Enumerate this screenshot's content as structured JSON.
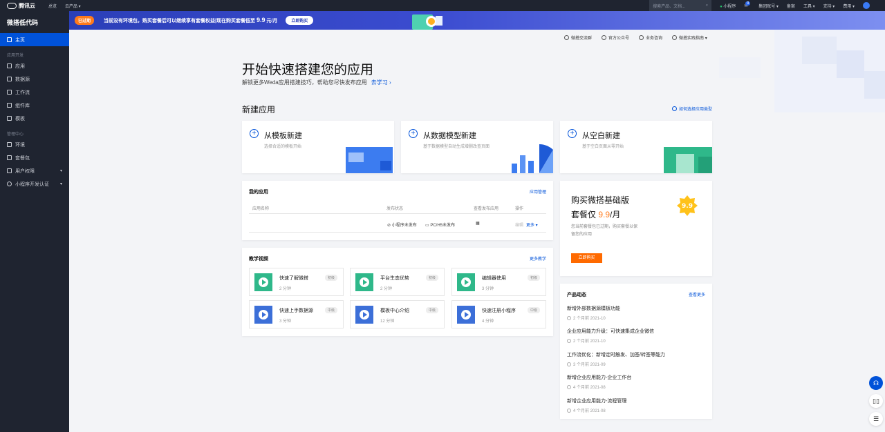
{
  "topbar": {
    "brand": "腾讯云",
    "nav": [
      "总览",
      "云产品 ▾"
    ],
    "search_placeholder": "搜索产品、文档...",
    "right_links": [
      "小程序",
      "集团账号 ▾",
      "备案",
      "工具 ▾",
      "支持 ▾",
      "费用 ▾"
    ],
    "mail_badge": "9"
  },
  "sidebar": {
    "title": "微搭低代码",
    "home": "主页",
    "group1": "应用开发",
    "group1_items": [
      "应用",
      "数据源",
      "工作流",
      "组件库",
      "模板"
    ],
    "group2": "管理中心",
    "group2_items": [
      "环境",
      "套餐包",
      "用户权限",
      "小程序开发认证"
    ]
  },
  "banner": {
    "expired": "已过期",
    "message": "当前没有环境包，购买套餐后可以继续享有套餐权益|现在购买套餐低至",
    "price": "9.9",
    "unit": "元/月",
    "buy_button": "立即购买"
  },
  "links": [
    "微搭交流群",
    "官方公众号",
    "业务咨询",
    "微搭实践指南 ▾"
  ],
  "hero": {
    "title": "开始快速搭建您的应用",
    "subtitle": "解锁更多Weda应用搭建技巧，帮助您尽快发布应用",
    "learn": "去学习 ›"
  },
  "create": {
    "title": "新建应用",
    "help": "如何选择应用类型",
    "cards": [
      {
        "title": "从模板新建",
        "desc": "选择合适的模板开始"
      },
      {
        "title": "从数据模型新建",
        "desc": "基于数据模型自动生成增删改查页面"
      },
      {
        "title": "从空白新建",
        "desc": "基于空白页面从零开始"
      }
    ]
  },
  "my_apps": {
    "title": "我的应用",
    "manage": "应用管理",
    "columns": [
      "应用名称",
      "发布状态",
      "查看发布应用",
      "操作"
    ],
    "row": {
      "status1": "小程序未发布",
      "status2": "PC/H5未发布",
      "edit": "编辑",
      "more": "更多 ▾"
    }
  },
  "videos": {
    "title": "教学视频",
    "more": "更多教学",
    "items": [
      {
        "title": "快速了解微搭",
        "duration": "2 分钟",
        "level": "初级"
      },
      {
        "title": "平台生态优势",
        "duration": "2 分钟",
        "level": "初级"
      },
      {
        "title": "编辑器使用",
        "duration": "3 分钟",
        "level": "初级"
      },
      {
        "title": "快速上手数据源",
        "duration": "3 分钟",
        "level": "中级"
      },
      {
        "title": "模板中心介绍",
        "duration": "12 分钟",
        "level": "中级"
      },
      {
        "title": "快速注册小程序",
        "duration": "4 分钟",
        "level": "中级"
      }
    ]
  },
  "buy": {
    "line1": "购买微搭基础版",
    "line2_prefix": "套餐仅 ",
    "price": "9.9",
    "line2_suffix": "/月",
    "desc": "您当前套餐包已过期，购买套餐以保留您的应用",
    "button": "立即购买",
    "stamp": "9.9"
  },
  "news": {
    "title": "产品动态",
    "more": "查看更多",
    "items": [
      {
        "text": "新增外部数据源模板功能",
        "time": "2 个月前 2021-10"
      },
      {
        "text": "企业应用能力升级：可快速集成企业微信",
        "time": "2 个月前 2021-10"
      },
      {
        "text": "工作流优化：新增定时触发、加签/转签等能力",
        "time": "3 个月前 2021-09"
      },
      {
        "text": "新增企业应用能力-企业工作台",
        "time": "4 个月前 2021-08"
      },
      {
        "text": "新增企业应用能力-流程管理",
        "time": "4 个月前 2021-08"
      }
    ]
  },
  "colors": {
    "accent": "#0052d9",
    "orange": "#ff7a1a",
    "sidebar": "#1f2430"
  }
}
